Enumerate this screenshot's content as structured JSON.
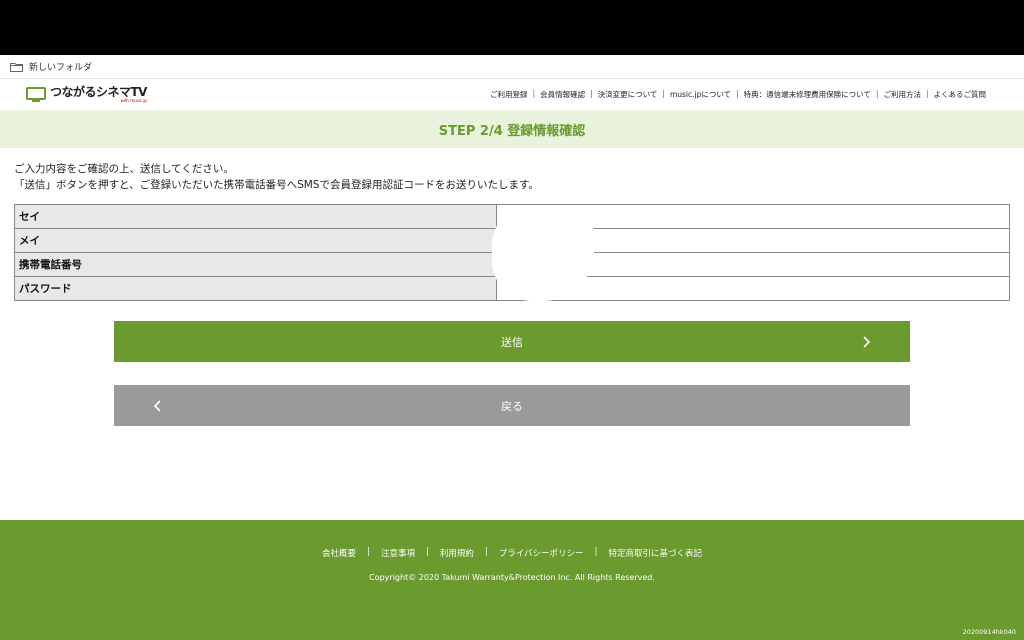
{
  "bookmarks": {
    "folder_label": "新しいフォルダ",
    "folder_icon": "folder-icon"
  },
  "header": {
    "logo_text": "つながるシネマTV",
    "logo_sub": "with music.jp",
    "logo_icon": "tv-icon",
    "nav": [
      "ご利用登録",
      "会員情報確認",
      "決済変更について",
      "music.jpについて",
      "特典：通信端末修理費用保険について",
      "ご利用方法",
      "よくあるご質問"
    ]
  },
  "step": {
    "title": "STEP 2/4 登録情報確認"
  },
  "instructions": {
    "line1": "ご入力内容をご確認の上、送信してください。",
    "line2": "「送信」ボタンを押すと、ご登録いただいた携帯電話番号へSMSで会員登録用認証コードをお送りいたします。"
  },
  "table": {
    "rows": [
      {
        "label": "セイ",
        "value": ""
      },
      {
        "label": "メイ",
        "value": ""
      },
      {
        "label": "携帯電話番号",
        "value": ""
      },
      {
        "label": "パスワード",
        "value": ""
      }
    ]
  },
  "buttons": {
    "submit_label": "送信",
    "back_label": "戻る"
  },
  "footer": {
    "links": [
      "会社概要",
      "注意事項",
      "利用規約",
      "プライバシーポリシー",
      "特定商取引に基づく表記"
    ],
    "separator": "|",
    "copyright": "Copyright© 2020 Takumi Warranty&Protection Inc. All Rights Reserved.",
    "build_id": "20200914hk040"
  },
  "colors": {
    "brand_green": "#6b9a2f",
    "step_bg": "#e9f2dc",
    "back_gray": "#9a9a9a"
  }
}
